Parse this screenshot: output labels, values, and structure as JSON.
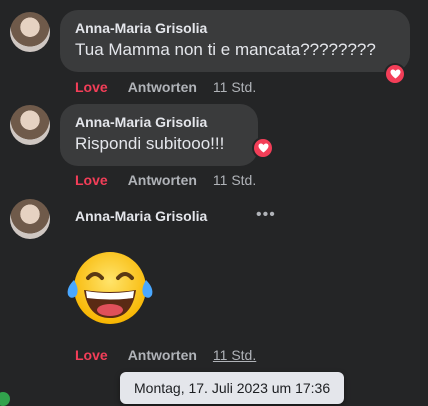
{
  "comments": [
    {
      "author": "Anna-Maria Grisolia",
      "text": "Tua Mamma non ti e mancata????????",
      "love_label": "Love",
      "reply_label": "Antworten",
      "time": "11 Std."
    },
    {
      "author": "Anna-Maria Grisolia",
      "text": "Rispondi subitooo!!!",
      "love_label": "Love",
      "reply_label": "Antworten",
      "time": "11 Std."
    },
    {
      "author": "Anna-Maria Grisolia",
      "more_label": "•••",
      "love_label": "Love",
      "reply_label": "Antworten",
      "time": "11 Std."
    }
  ],
  "tooltip": "Montag, 17. Juli 2023 um 17:36",
  "colors": {
    "background": "#242526",
    "bubble": "#3a3b3c",
    "love": "#f33e58",
    "secondary_text": "#b0b3b8"
  },
  "icons": {
    "reaction": "heart-icon",
    "sticker": "laughing-tears-emoji-icon"
  }
}
